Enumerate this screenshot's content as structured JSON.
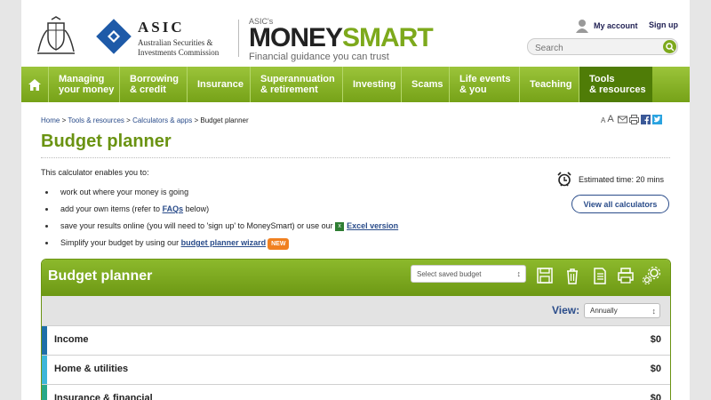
{
  "header": {
    "asic_name": "ASIC",
    "asic_sub_line1": "Australian Securities &",
    "asic_sub_line2": "Investments Commission",
    "moneysmart_asics": "ASIC's",
    "moneysmart_money": "MONEY",
    "moneysmart_smart": "SMART",
    "tagline": "Financial guidance you can trust",
    "my_account": "My account",
    "sign_up": "Sign up",
    "search_placeholder": "Search"
  },
  "nav": {
    "items": [
      {
        "l1": "Managing",
        "l2": "your money"
      },
      {
        "l1": "Borrowing",
        "l2": "& credit"
      },
      {
        "l1": "Insurance",
        "l2": ""
      },
      {
        "l1": "Superannuation",
        "l2": "& retirement"
      },
      {
        "l1": "Investing",
        "l2": ""
      },
      {
        "l1": "Scams",
        "l2": ""
      },
      {
        "l1": "Life events",
        "l2": "& you"
      },
      {
        "l1": "Teaching",
        "l2": ""
      },
      {
        "l1": "Tools",
        "l2": "& resources"
      }
    ]
  },
  "breadcrumb": {
    "home": "Home",
    "tools": "Tools & resources",
    "calculators": "Calculators & apps",
    "current": "Budget planner",
    "sep": ">"
  },
  "tools": {
    "a_small": "A",
    "a_big": "A"
  },
  "page": {
    "title": "Budget planner",
    "intro": "This calculator enables you to:",
    "items": {
      "i1": "work out where your money is going",
      "i2_pre": "add your own items (refer to ",
      "i2_link": "FAQs",
      "i2_post": " below)",
      "i3_pre": "save your results online (you will need to 'sign up' to MoneySmart) or use our ",
      "i3_link": "Excel version",
      "i4_pre": "Simplify your budget by using our ",
      "i4_link": "budget planner wizard",
      "new_badge": "NEW"
    },
    "estimated_time": "Estimated time: 20 mins",
    "view_all": "View all calculators"
  },
  "widget": {
    "title": "Budget planner",
    "saved_placeholder": "Select saved budget",
    "view_label": "View:",
    "view_value": "Annually",
    "categories": [
      {
        "label": "Income",
        "value": "$0",
        "color": "#1e6fa8"
      },
      {
        "label": "Home & utilities",
        "value": "$0",
        "color": "#3db6d9"
      },
      {
        "label": "Insurance & financial",
        "value": "$0",
        "color": "#27a889"
      }
    ]
  }
}
